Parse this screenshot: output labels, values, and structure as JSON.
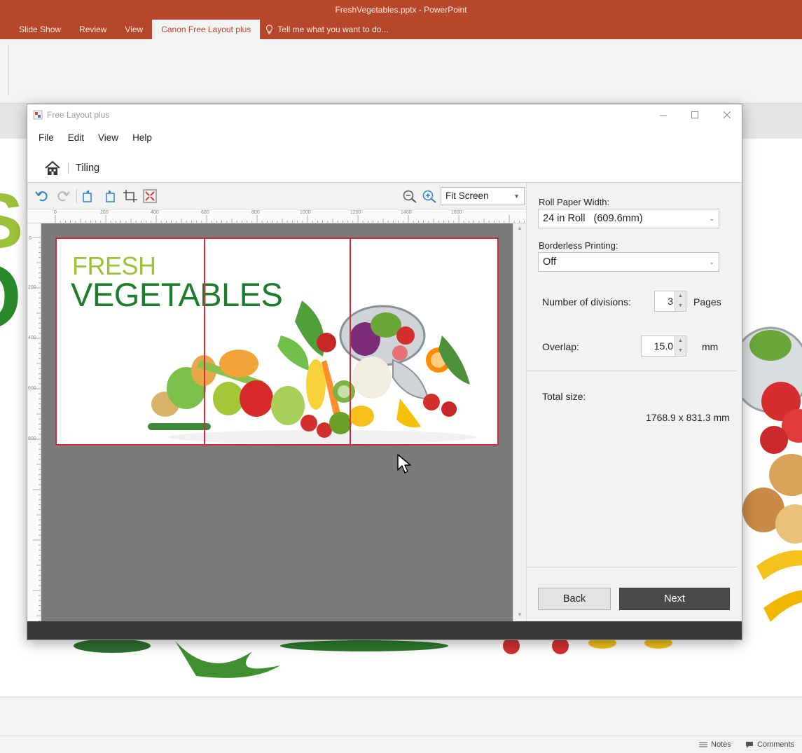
{
  "ppt": {
    "title": "FreshVegetables.pptx - PowerPoint",
    "tabs": [
      {
        "label": "Slide Show"
      },
      {
        "label": "Review"
      },
      {
        "label": "View"
      },
      {
        "label": "Canon Free Layout plus"
      }
    ],
    "tell_me": "Tell me what you want to do...",
    "status": {
      "notes": "Notes",
      "comments": "Comments"
    }
  },
  "dialog": {
    "title": "Free Layout plus",
    "menu": [
      "File",
      "Edit",
      "View",
      "Help"
    ],
    "breadcrumb": "Tiling",
    "zoom": "Fit Screen",
    "ruler_top_labels": [
      "0",
      "200",
      "400",
      "600",
      "800",
      "1000",
      "1200",
      "1400",
      "1600"
    ],
    "ruler_left_labels": [
      "0",
      "200",
      "400",
      "600",
      "800"
    ],
    "preview": {
      "line1": "FRESH",
      "line2": "VEGETABLES"
    },
    "panel": {
      "roll_width_label": "Roll Paper Width:",
      "roll_width_value": "24 in Roll   (609.6mm)",
      "borderless_label": "Borderless Printing:",
      "borderless_value": "Off",
      "divisions_label": "Number of divisions:",
      "divisions_value": "3",
      "divisions_unit": "Pages",
      "overlap_label": "Overlap:",
      "overlap_value": "15.0",
      "overlap_unit": "mm",
      "total_label": "Total size:",
      "total_value": "1768.9 x 831.3 mm",
      "back": "Back",
      "next": "Next"
    }
  },
  "colors": {
    "ppt_red": "#b7472a",
    "fresh_green": "#9cc13b",
    "vegetables_green": "#1e7d2c",
    "tile_border": "#cf2e3a",
    "next_button": "#4a4a4a"
  }
}
